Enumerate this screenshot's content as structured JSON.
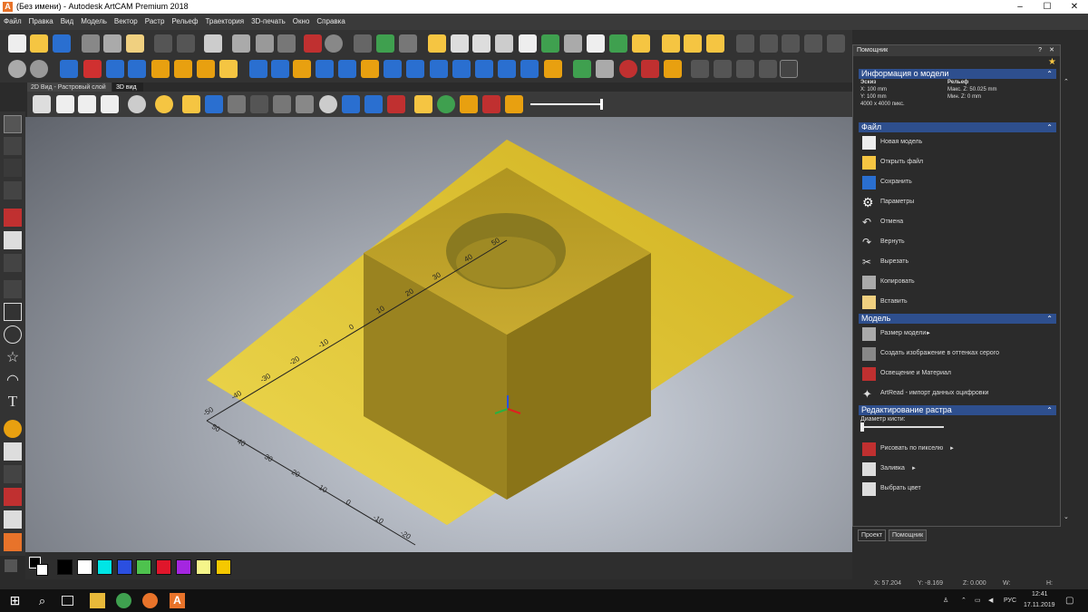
{
  "window": {
    "title": "(Без имени) - Autodesk ArtCAM Premium 2018",
    "app_icon": "A",
    "controls": [
      "–",
      "☐",
      "✕"
    ]
  },
  "menu": [
    "Файл",
    "Правка",
    "Вид",
    "Модель",
    "Вектор",
    "Растр",
    "Рельеф",
    "Траектория",
    "3D-печать",
    "Окно",
    "Справка"
  ],
  "tabs": [
    {
      "label": "2D Вид - Растровый слой",
      "active": false
    },
    {
      "label": "3D вид",
      "active": true
    }
  ],
  "palette": {
    "colors": [
      "#000000",
      "#ffffff",
      "#00e5e5",
      "#2b4fe0",
      "#4ec24e",
      "#e0162b",
      "#a426e0",
      "#f5f58a",
      "#f5c800"
    ]
  },
  "status": {
    "x": "X: 57.204",
    "y": "Y: -8.169",
    "z": "Z: 0.000",
    "w": "W:",
    "h": "H:"
  },
  "helper_panel": {
    "title": "Помощник",
    "help": "?",
    "close": "✕",
    "model_info": {
      "header": "Информация о модели",
      "sketch_label": "Эскиз",
      "sketch_x": "X: 100 mm",
      "sketch_y": "Y: 100 mm",
      "sketch_px": "4000 x 4000 пикс.",
      "relief_label": "Рельеф",
      "relief_max": "Макс. Z: 50.025 mm",
      "relief_min": "Мин. Z: 0 mm"
    },
    "file": {
      "header": "Файл",
      "items": [
        "Новая модель",
        "Открыть файл",
        "Сохранить",
        "Параметры",
        "Отмена",
        "Вернуть",
        "Вырезать",
        "Копировать",
        "Вставить"
      ]
    },
    "model": {
      "header": "Модель",
      "items": [
        "Размер модели",
        "Создать изображение в оттенках серого",
        "Освещение и Материал",
        "ArtRead - импорт данных оцифровки"
      ]
    },
    "raster_edit": {
      "header": "Редактирование растра",
      "brush_label": "Диаметр кисти:",
      "brush_value": 0.02,
      "items": [
        "Рисовать по пикселю",
        "Заливка",
        "Выбрать цвет"
      ]
    },
    "bottom_tabs": [
      "Проект",
      "Помощник"
    ]
  },
  "viewport": {
    "ruler_labels": [
      "50",
      "40",
      "30",
      "20",
      "10",
      "0",
      "-10",
      "-20",
      "-30",
      "-40",
      "-50"
    ],
    "ruler2_labels": [
      "50",
      "40",
      "30",
      "20",
      "10",
      "0",
      "-10",
      "-20",
      "-30",
      "-40",
      "-50"
    ]
  },
  "taskbar": {
    "lang": "РУС",
    "time": "12:41",
    "date": "17.11.2019"
  }
}
